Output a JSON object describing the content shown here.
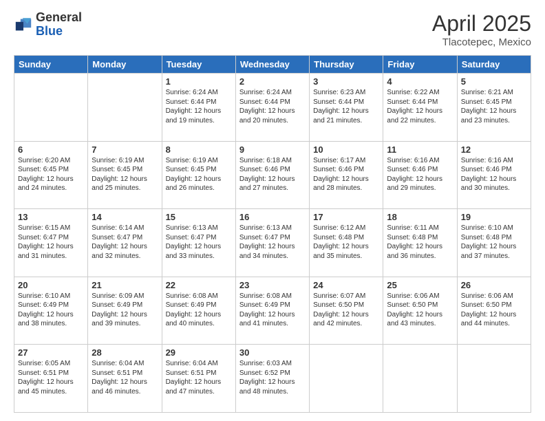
{
  "logo": {
    "general": "General",
    "blue": "Blue"
  },
  "header": {
    "month": "April 2025",
    "location": "Tlacotepec, Mexico"
  },
  "weekdays": [
    "Sunday",
    "Monday",
    "Tuesday",
    "Wednesday",
    "Thursday",
    "Friday",
    "Saturday"
  ],
  "weeks": [
    [
      {
        "day": "",
        "info": ""
      },
      {
        "day": "",
        "info": ""
      },
      {
        "day": "1",
        "info": "Sunrise: 6:24 AM\nSunset: 6:44 PM\nDaylight: 12 hours\nand 19 minutes."
      },
      {
        "day": "2",
        "info": "Sunrise: 6:24 AM\nSunset: 6:44 PM\nDaylight: 12 hours\nand 20 minutes."
      },
      {
        "day": "3",
        "info": "Sunrise: 6:23 AM\nSunset: 6:44 PM\nDaylight: 12 hours\nand 21 minutes."
      },
      {
        "day": "4",
        "info": "Sunrise: 6:22 AM\nSunset: 6:44 PM\nDaylight: 12 hours\nand 22 minutes."
      },
      {
        "day": "5",
        "info": "Sunrise: 6:21 AM\nSunset: 6:45 PM\nDaylight: 12 hours\nand 23 minutes."
      }
    ],
    [
      {
        "day": "6",
        "info": "Sunrise: 6:20 AM\nSunset: 6:45 PM\nDaylight: 12 hours\nand 24 minutes."
      },
      {
        "day": "7",
        "info": "Sunrise: 6:19 AM\nSunset: 6:45 PM\nDaylight: 12 hours\nand 25 minutes."
      },
      {
        "day": "8",
        "info": "Sunrise: 6:19 AM\nSunset: 6:45 PM\nDaylight: 12 hours\nand 26 minutes."
      },
      {
        "day": "9",
        "info": "Sunrise: 6:18 AM\nSunset: 6:46 PM\nDaylight: 12 hours\nand 27 minutes."
      },
      {
        "day": "10",
        "info": "Sunrise: 6:17 AM\nSunset: 6:46 PM\nDaylight: 12 hours\nand 28 minutes."
      },
      {
        "day": "11",
        "info": "Sunrise: 6:16 AM\nSunset: 6:46 PM\nDaylight: 12 hours\nand 29 minutes."
      },
      {
        "day": "12",
        "info": "Sunrise: 6:16 AM\nSunset: 6:46 PM\nDaylight: 12 hours\nand 30 minutes."
      }
    ],
    [
      {
        "day": "13",
        "info": "Sunrise: 6:15 AM\nSunset: 6:47 PM\nDaylight: 12 hours\nand 31 minutes."
      },
      {
        "day": "14",
        "info": "Sunrise: 6:14 AM\nSunset: 6:47 PM\nDaylight: 12 hours\nand 32 minutes."
      },
      {
        "day": "15",
        "info": "Sunrise: 6:13 AM\nSunset: 6:47 PM\nDaylight: 12 hours\nand 33 minutes."
      },
      {
        "day": "16",
        "info": "Sunrise: 6:13 AM\nSunset: 6:47 PM\nDaylight: 12 hours\nand 34 minutes."
      },
      {
        "day": "17",
        "info": "Sunrise: 6:12 AM\nSunset: 6:48 PM\nDaylight: 12 hours\nand 35 minutes."
      },
      {
        "day": "18",
        "info": "Sunrise: 6:11 AM\nSunset: 6:48 PM\nDaylight: 12 hours\nand 36 minutes."
      },
      {
        "day": "19",
        "info": "Sunrise: 6:10 AM\nSunset: 6:48 PM\nDaylight: 12 hours\nand 37 minutes."
      }
    ],
    [
      {
        "day": "20",
        "info": "Sunrise: 6:10 AM\nSunset: 6:49 PM\nDaylight: 12 hours\nand 38 minutes."
      },
      {
        "day": "21",
        "info": "Sunrise: 6:09 AM\nSunset: 6:49 PM\nDaylight: 12 hours\nand 39 minutes."
      },
      {
        "day": "22",
        "info": "Sunrise: 6:08 AM\nSunset: 6:49 PM\nDaylight: 12 hours\nand 40 minutes."
      },
      {
        "day": "23",
        "info": "Sunrise: 6:08 AM\nSunset: 6:49 PM\nDaylight: 12 hours\nand 41 minutes."
      },
      {
        "day": "24",
        "info": "Sunrise: 6:07 AM\nSunset: 6:50 PM\nDaylight: 12 hours\nand 42 minutes."
      },
      {
        "day": "25",
        "info": "Sunrise: 6:06 AM\nSunset: 6:50 PM\nDaylight: 12 hours\nand 43 minutes."
      },
      {
        "day": "26",
        "info": "Sunrise: 6:06 AM\nSunset: 6:50 PM\nDaylight: 12 hours\nand 44 minutes."
      }
    ],
    [
      {
        "day": "27",
        "info": "Sunrise: 6:05 AM\nSunset: 6:51 PM\nDaylight: 12 hours\nand 45 minutes."
      },
      {
        "day": "28",
        "info": "Sunrise: 6:04 AM\nSunset: 6:51 PM\nDaylight: 12 hours\nand 46 minutes."
      },
      {
        "day": "29",
        "info": "Sunrise: 6:04 AM\nSunset: 6:51 PM\nDaylight: 12 hours\nand 47 minutes."
      },
      {
        "day": "30",
        "info": "Sunrise: 6:03 AM\nSunset: 6:52 PM\nDaylight: 12 hours\nand 48 minutes."
      },
      {
        "day": "",
        "info": ""
      },
      {
        "day": "",
        "info": ""
      },
      {
        "day": "",
        "info": ""
      }
    ]
  ]
}
